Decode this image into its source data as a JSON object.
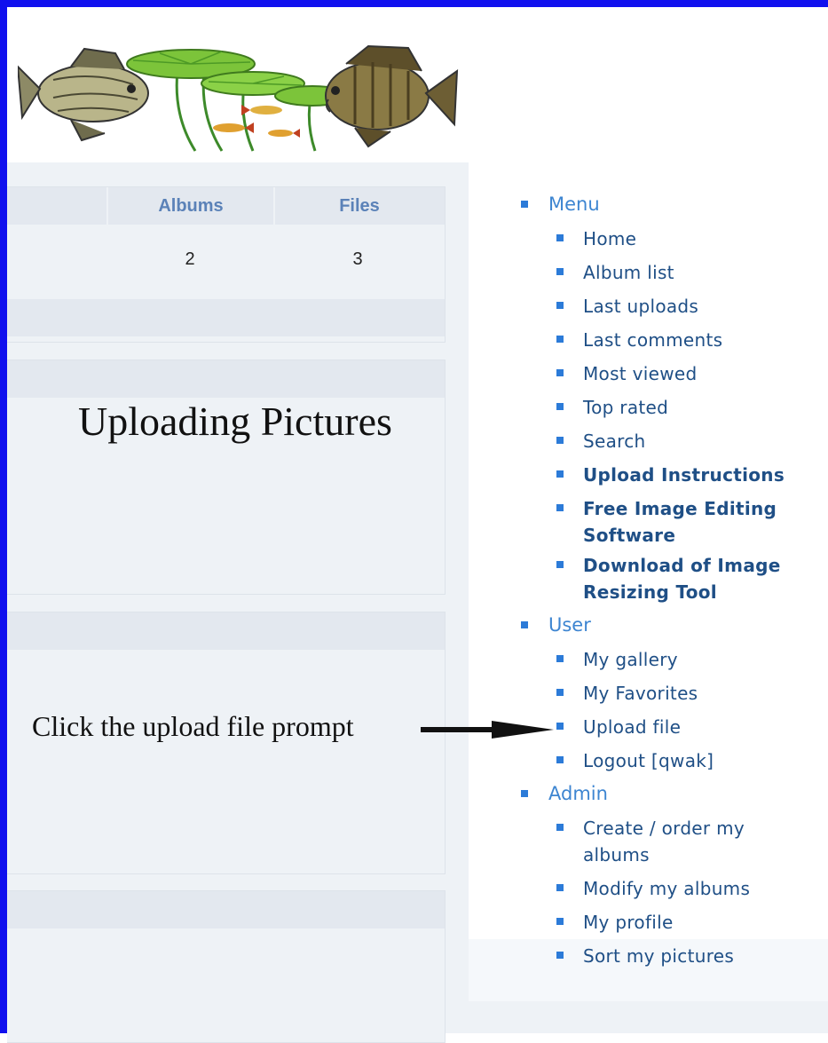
{
  "stats_table": {
    "headers": {
      "albums": "Albums",
      "files": "Files"
    },
    "row": {
      "albums": "2",
      "files": "3"
    }
  },
  "annotations": {
    "heading": "Uploading Pictures",
    "callout": "Click the upload file prompt"
  },
  "sidebar": {
    "menu": {
      "label": "Menu",
      "items": [
        {
          "label": "Home",
          "bold": false
        },
        {
          "label": "Album list",
          "bold": false
        },
        {
          "label": "Last uploads",
          "bold": false
        },
        {
          "label": "Last comments",
          "bold": false
        },
        {
          "label": "Most viewed",
          "bold": false
        },
        {
          "label": "Top rated",
          "bold": false
        },
        {
          "label": "Search",
          "bold": false
        },
        {
          "label": "Upload Instructions",
          "bold": true
        },
        {
          "label": "Free Image Editing Software",
          "bold": true
        },
        {
          "label": "Download of Image Resizing Tool",
          "bold": true
        }
      ]
    },
    "user": {
      "label": "User",
      "items": [
        {
          "label": "My gallery"
        },
        {
          "label": "My Favorites"
        },
        {
          "label": "Upload file"
        },
        {
          "label": "Logout [qwak]"
        }
      ]
    },
    "admin": {
      "label": "Admin",
      "items": [
        {
          "label": "Create / order my albums"
        },
        {
          "label": "Modify my albums"
        },
        {
          "label": "My profile"
        },
        {
          "label": "Sort my pictures"
        }
      ]
    }
  },
  "colors": {
    "frame": "#1010ee",
    "bullet": "#2c7bd8",
    "section_link": "#3d85d1",
    "item_link": "#1f4f86",
    "table_header_text": "#5b82b8"
  }
}
